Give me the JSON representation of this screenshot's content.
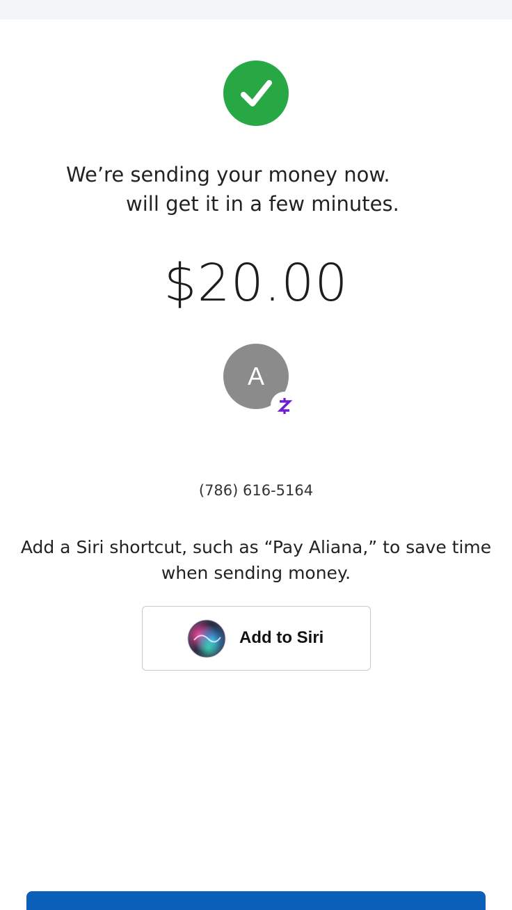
{
  "status": {
    "icon": "check-icon",
    "color": "#27a844"
  },
  "message": {
    "line1": "We’re sending your money now.",
    "line2": "will get it in a few minutes."
  },
  "amount": "$20.00",
  "recipient": {
    "initial": "A",
    "badge_icon": "zelle-icon",
    "phone": "(786) 616-5164"
  },
  "siri": {
    "text": "Add a Siri shortcut, such as “Pay Aliana,” to save time when sending money.",
    "button_label": "Add to Siri",
    "icon": "siri-icon"
  },
  "accent_color": "#0b5fb8"
}
